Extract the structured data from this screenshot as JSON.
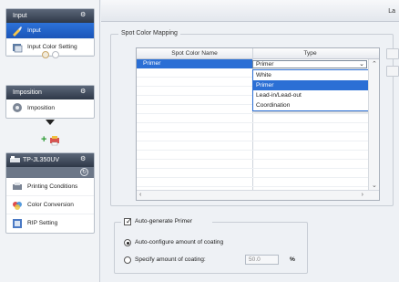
{
  "sidebar": {
    "panels": [
      {
        "title": "Input",
        "items": [
          {
            "label": "Input",
            "icon": "input-icon",
            "selected": true
          },
          {
            "label": "Input Color Setting",
            "icon": "color-setting-icon",
            "selected": false
          }
        ]
      },
      {
        "title": "Imposition",
        "items": [
          {
            "label": "Imposition",
            "icon": "imposition-icon",
            "selected": false
          }
        ]
      },
      {
        "title": "TP-JL350UV",
        "items": [
          {
            "label": "Printing Conditions",
            "icon": "printing-conditions-icon",
            "selected": false
          },
          {
            "label": "Color Conversion",
            "icon": "color-conversion-icon",
            "selected": false
          },
          {
            "label": "RIP Setting",
            "icon": "rip-setting-icon",
            "selected": false
          }
        ]
      }
    ]
  },
  "topstrip": {
    "label": "La"
  },
  "spot_mapping": {
    "title": "Spot Color Mapping",
    "columns": [
      "Spot Color Name",
      "Type"
    ],
    "rows": [
      {
        "name": "Primer",
        "type": "Primer"
      }
    ],
    "dropdown_options": [
      "White",
      "Primer",
      "Lead-in/Lead-out",
      "Coordination"
    ],
    "dropdown_selected": "Primer"
  },
  "primer": {
    "auto_generate_label": "Auto-generate Primer",
    "auto_generate_checked": true,
    "auto_configure_label": "Auto-configure amount of coating",
    "specify_label": "Specify amount of coating:",
    "amount_value": "50.0",
    "unit": "%"
  }
}
